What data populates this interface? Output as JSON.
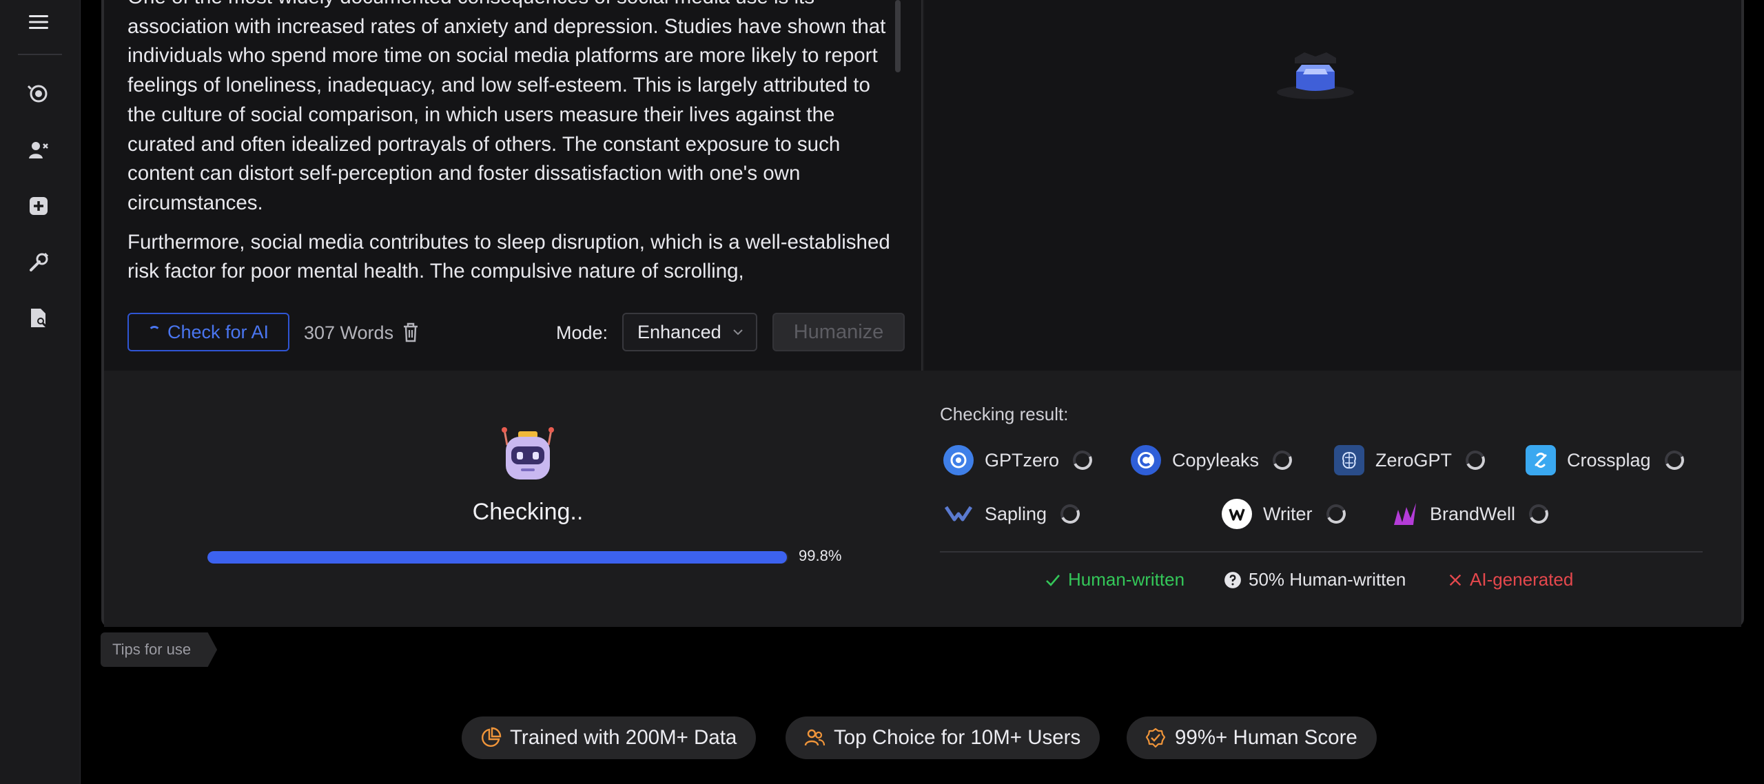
{
  "sidebar": {
    "items": [
      {
        "name": "menu-icon"
      },
      {
        "name": "ai-detector-icon"
      },
      {
        "name": "humanize-icon"
      },
      {
        "name": "add-icon"
      },
      {
        "name": "tools-icon"
      },
      {
        "name": "plagiarism-check-icon"
      }
    ]
  },
  "editor": {
    "paragraphs": [
      "One of the most widely documented consequences of social media use is its association with increased rates of anxiety and depression. Studies have shown that individuals who spend more time on social media platforms are more likely to report feelings of loneliness, inadequacy, and low self-esteem. This is largely attributed to the culture of social comparison, in which users measure their lives against the curated and often idealized portrayals of others. The constant exposure to such content can distort self-perception and foster dissatisfaction with one's own circumstances.",
      "Furthermore, social media contributes to sleep disruption, which is a well-established risk factor for poor mental health. The compulsive nature of scrolling,"
    ],
    "check_button": "Check for AI",
    "word_count": "307 Words",
    "mode_label": "Mode:",
    "mode_value": "Enhanced",
    "humanize_button": "Humanize"
  },
  "results": {
    "status": "Checking..",
    "progress_label": "99.8%",
    "progress_fraction": 0.998,
    "title": "Checking result:",
    "detectors": [
      {
        "name": "GPTzero",
        "color": "#3f7fe8"
      },
      {
        "name": "Copyleaks",
        "color": "#2f5fd8"
      },
      {
        "name": "ZeroGPT",
        "color": "#2a4d8a"
      },
      {
        "name": "Crossplag",
        "color": "#3aa8f0"
      },
      {
        "name": "Sapling",
        "color": "#5a7ad0"
      },
      {
        "name": "Writer",
        "color": "#ffffff"
      },
      {
        "name": "BrandWell",
        "color": "#b43cd8"
      }
    ],
    "legend": {
      "human": "Human-written",
      "half": "50% Human-written",
      "ai": "AI-generated"
    },
    "colors": {
      "human": "#34c759",
      "half": "#e6e6ea",
      "ai": "#e5484d",
      "accent": "#3c62ef"
    }
  },
  "tips": "Tips for use",
  "badges": [
    "Trained with 200M+ Data",
    "Top Choice for 10M+ Users",
    "99%+ Human Score"
  ]
}
